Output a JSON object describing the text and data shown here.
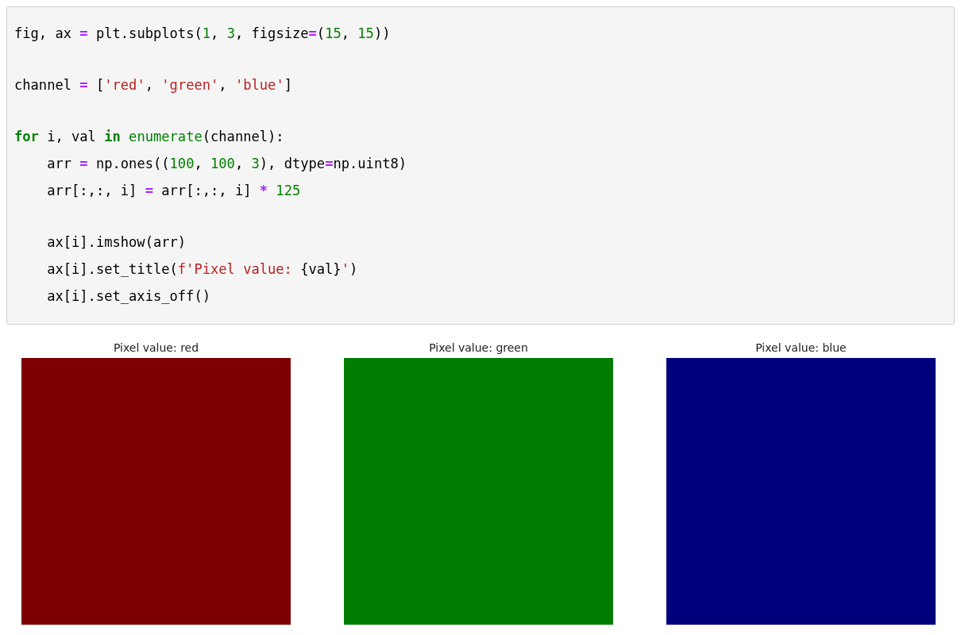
{
  "code_cell": {
    "lines": [
      {
        "kind": "code",
        "tokens": [
          {
            "kind": "plain",
            "t": "fig, ax "
          },
          {
            "kind": "op",
            "t": "="
          },
          {
            "kind": "plain",
            "t": " plt.subplots("
          },
          {
            "kind": "num",
            "t": "1"
          },
          {
            "kind": "plain",
            "t": ", "
          },
          {
            "kind": "num",
            "t": "3"
          },
          {
            "kind": "plain",
            "t": ", figsize"
          },
          {
            "kind": "op",
            "t": "="
          },
          {
            "kind": "plain",
            "t": "("
          },
          {
            "kind": "num",
            "t": "15"
          },
          {
            "kind": "plain",
            "t": ", "
          },
          {
            "kind": "num",
            "t": "15"
          },
          {
            "kind": "plain",
            "t": "))"
          }
        ]
      },
      {
        "kind": "blank"
      },
      {
        "kind": "code",
        "tokens": [
          {
            "kind": "plain",
            "t": "channel "
          },
          {
            "kind": "op",
            "t": "="
          },
          {
            "kind": "plain",
            "t": " ["
          },
          {
            "kind": "str",
            "t": "'red'"
          },
          {
            "kind": "plain",
            "t": ", "
          },
          {
            "kind": "str",
            "t": "'green'"
          },
          {
            "kind": "plain",
            "t": ", "
          },
          {
            "kind": "str",
            "t": "'blue'"
          },
          {
            "kind": "plain",
            "t": "]"
          }
        ]
      },
      {
        "kind": "blank"
      },
      {
        "kind": "code",
        "tokens": [
          {
            "kind": "kw",
            "t": "for"
          },
          {
            "kind": "plain",
            "t": " i, val "
          },
          {
            "kind": "kw",
            "t": "in "
          },
          {
            "kind": "builtin",
            "t": "enumerate"
          },
          {
            "kind": "plain",
            "t": "(channel):"
          }
        ]
      },
      {
        "kind": "code",
        "tokens": [
          {
            "kind": "plain",
            "t": "    arr "
          },
          {
            "kind": "op",
            "t": "="
          },
          {
            "kind": "plain",
            "t": " np.ones(("
          },
          {
            "kind": "num",
            "t": "100"
          },
          {
            "kind": "plain",
            "t": ", "
          },
          {
            "kind": "num",
            "t": "100"
          },
          {
            "kind": "plain",
            "t": ", "
          },
          {
            "kind": "num",
            "t": "3"
          },
          {
            "kind": "plain",
            "t": "), dtype"
          },
          {
            "kind": "op",
            "t": "="
          },
          {
            "kind": "plain",
            "t": "np.uint8)"
          }
        ]
      },
      {
        "kind": "code",
        "tokens": [
          {
            "kind": "plain",
            "t": "    arr[:,:, i] "
          },
          {
            "kind": "op",
            "t": "="
          },
          {
            "kind": "plain",
            "t": " arr[:,:, i] "
          },
          {
            "kind": "op",
            "t": "* "
          },
          {
            "kind": "num",
            "t": "125"
          }
        ]
      },
      {
        "kind": "blank"
      },
      {
        "kind": "code",
        "tokens": [
          {
            "kind": "plain",
            "t": "    ax[i].imshow(arr)"
          }
        ]
      },
      {
        "kind": "code",
        "tokens": [
          {
            "kind": "plain",
            "t": "    ax[i].set_title("
          },
          {
            "kind": "str",
            "t": "f'Pixel value: "
          },
          {
            "kind": "plain",
            "t": "{val}"
          },
          {
            "kind": "str",
            "t": "'"
          },
          {
            "kind": "plain",
            "t": ")"
          }
        ]
      },
      {
        "kind": "code",
        "tokens": [
          {
            "kind": "plain",
            "t": "    ax[i].set_axis_off()"
          }
        ]
      }
    ]
  },
  "output": {
    "panels": [
      {
        "title": "Pixel value: red",
        "color": "#7d0000"
      },
      {
        "title": "Pixel value: green",
        "color": "#007d00"
      },
      {
        "title": "Pixel value: blue",
        "color": "#00007d"
      }
    ]
  }
}
